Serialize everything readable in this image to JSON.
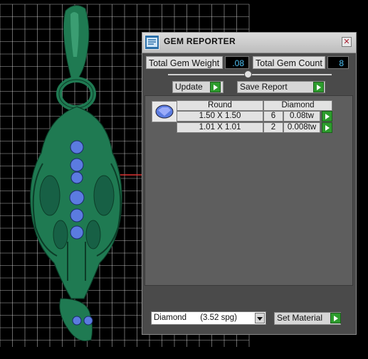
{
  "viewport": {
    "grid_color": "#e8e8e8",
    "model_color": "#1f7a52",
    "gem_color": "#5b7be0",
    "axis_color": "#d33"
  },
  "panel": {
    "title": "GEM REPORTER",
    "title_icon": "gem-reporter-icon",
    "close_icon": "close-icon",
    "total_gem_weight_label": "Total Gem Weight",
    "total_gem_weight_value": ".08",
    "total_gem_count_label": "Total Gem Count",
    "total_gem_count_value": "8",
    "update_label": "Update",
    "save_report_label": "Save Report",
    "table": {
      "headers": [
        "Round",
        "Diamond"
      ],
      "rows": [
        {
          "size": "1.50 X 1.50",
          "count": "6",
          "weight": "0.08tw"
        },
        {
          "size": "1.01 X 1.01",
          "count": "2",
          "weight": "0.008tw"
        }
      ]
    },
    "material_selected": "Diamond      (3.52 spg)",
    "set_material_label": "Set Material"
  }
}
